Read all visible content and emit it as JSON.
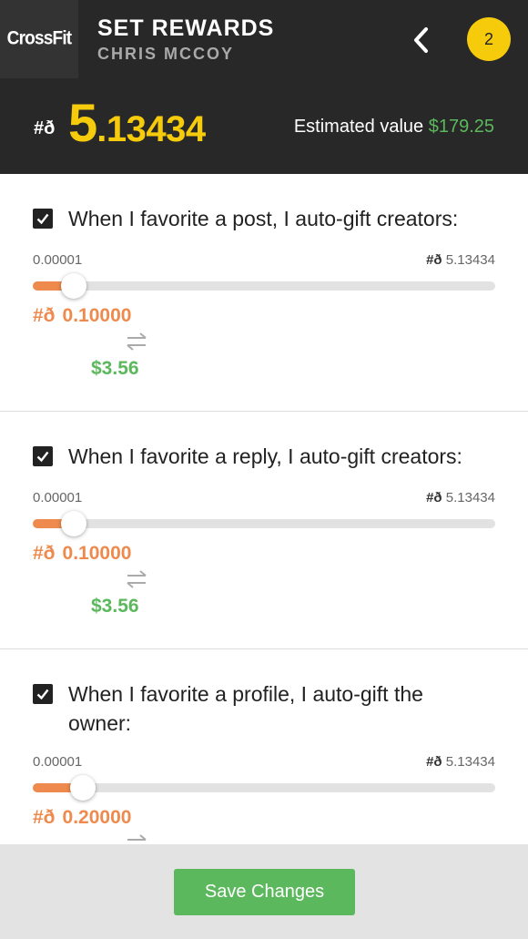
{
  "header": {
    "logo": "CrossFit",
    "title": "SET REWARDS",
    "subtitle": "CHRIS MCCOY",
    "badge_count": "2"
  },
  "balance": {
    "symbol": "#ð",
    "amount_big": "5",
    "amount_rest": ".13434",
    "estimated_label": "Estimated value ",
    "estimated_value": "$179.25"
  },
  "rewards": [
    {
      "checked": true,
      "label": "When I favorite a post, I auto-gift creators:",
      "min": "0.00001",
      "max_symbol": "#ð",
      "max": "5.13434",
      "amount_symbol": "#ð",
      "amount": "0.10000",
      "usd": "$3.56",
      "level": 0.0195
    },
    {
      "checked": true,
      "label": "When I favorite a reply, I auto-gift creators:",
      "min": "0.00001",
      "max_symbol": "#ð",
      "max": "5.13434",
      "amount_symbol": "#ð",
      "amount": "0.10000",
      "usd": "$3.56",
      "level": 0.0195
    },
    {
      "checked": true,
      "label": "When I favorite a profile, I auto-gift the owner:",
      "min": "0.00001",
      "max_symbol": "#ð",
      "max": "5.13434",
      "amount_symbol": "#ð",
      "amount": "0.20000",
      "usd": "",
      "level": 0.039
    }
  ],
  "footer": {
    "save_label": "Save Changes"
  },
  "colors": {
    "header_bg": "#282828",
    "accent_yellow": "#f5cb0b",
    "accent_orange": "#ee8a4d",
    "accent_green": "#5cb85c"
  },
  "icons": [
    "chevron-left-icon",
    "checkbox-checked-icon",
    "swap-arrows-icon"
  ]
}
